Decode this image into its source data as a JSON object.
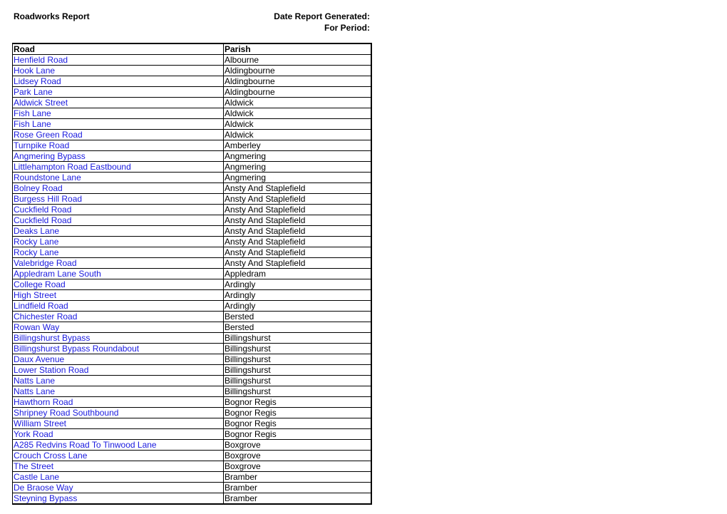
{
  "header": {
    "title": "Roadworks Report",
    "date_generated_label": "Date Report Generated:",
    "period_label": "For Period:"
  },
  "table": {
    "columns": [
      "Road",
      "Parish"
    ],
    "rows": [
      {
        "road": "Henfield Road",
        "parish": "Albourne"
      },
      {
        "road": "Hook Lane",
        "parish": "Aldingbourne"
      },
      {
        "road": "Lidsey Road",
        "parish": "Aldingbourne"
      },
      {
        "road": "Park Lane",
        "parish": "Aldingbourne"
      },
      {
        "road": "Aldwick Street",
        "parish": "Aldwick"
      },
      {
        "road": "Fish Lane",
        "parish": "Aldwick"
      },
      {
        "road": "Fish Lane",
        "parish": "Aldwick"
      },
      {
        "road": "Rose Green Road",
        "parish": "Aldwick"
      },
      {
        "road": "Turnpike Road",
        "parish": "Amberley"
      },
      {
        "road": "Angmering Bypass",
        "parish": "Angmering"
      },
      {
        "road": "Littlehampton Road Eastbound",
        "parish": "Angmering"
      },
      {
        "road": "Roundstone Lane",
        "parish": "Angmering"
      },
      {
        "road": "Bolney Road",
        "parish": "Ansty And Staplefield"
      },
      {
        "road": "Burgess Hill Road",
        "parish": "Ansty And Staplefield"
      },
      {
        "road": "Cuckfield Road",
        "parish": "Ansty And Staplefield"
      },
      {
        "road": "Cuckfield Road",
        "parish": "Ansty And Staplefield"
      },
      {
        "road": "Deaks Lane",
        "parish": "Ansty And Staplefield"
      },
      {
        "road": "Rocky Lane",
        "parish": "Ansty And Staplefield"
      },
      {
        "road": "Rocky Lane",
        "parish": "Ansty And Staplefield"
      },
      {
        "road": "Valebridge Road",
        "parish": "Ansty And Staplefield"
      },
      {
        "road": "Appledram Lane South",
        "parish": "Appledram"
      },
      {
        "road": "College Road",
        "parish": "Ardingly"
      },
      {
        "road": "High Street",
        "parish": "Ardingly"
      },
      {
        "road": "Lindfield Road",
        "parish": "Ardingly"
      },
      {
        "road": "Chichester Road",
        "parish": "Bersted"
      },
      {
        "road": "Rowan Way",
        "parish": "Bersted"
      },
      {
        "road": "Billingshurst Bypass",
        "parish": "Billingshurst"
      },
      {
        "road": "Billingshurst Bypass Roundabout",
        "parish": "Billingshurst"
      },
      {
        "road": "Daux Avenue",
        "parish": "Billingshurst"
      },
      {
        "road": "Lower Station Road",
        "parish": "Billingshurst"
      },
      {
        "road": "Natts Lane",
        "parish": "Billingshurst"
      },
      {
        "road": "Natts Lane",
        "parish": "Billingshurst"
      },
      {
        "road": "Hawthorn Road",
        "parish": "Bognor Regis"
      },
      {
        "road": "Shripney Road Southbound",
        "parish": "Bognor Regis"
      },
      {
        "road": "William Street",
        "parish": "Bognor Regis"
      },
      {
        "road": "York Road",
        "parish": "Bognor Regis"
      },
      {
        "road": "A285 Redvins Road To Tinwood Lane",
        "parish": "Boxgrove"
      },
      {
        "road": "Crouch Cross Lane",
        "parish": "Boxgrove"
      },
      {
        "road": "The Street",
        "parish": "Boxgrove"
      },
      {
        "road": "Castle Lane",
        "parish": "Bramber"
      },
      {
        "road": "De Braose Way",
        "parish": "Bramber"
      },
      {
        "road": "Steyning Bypass",
        "parish": "Bramber"
      }
    ]
  },
  "colors": {
    "link": "#1a1adf",
    "text": "#000000",
    "border": "#000000"
  }
}
